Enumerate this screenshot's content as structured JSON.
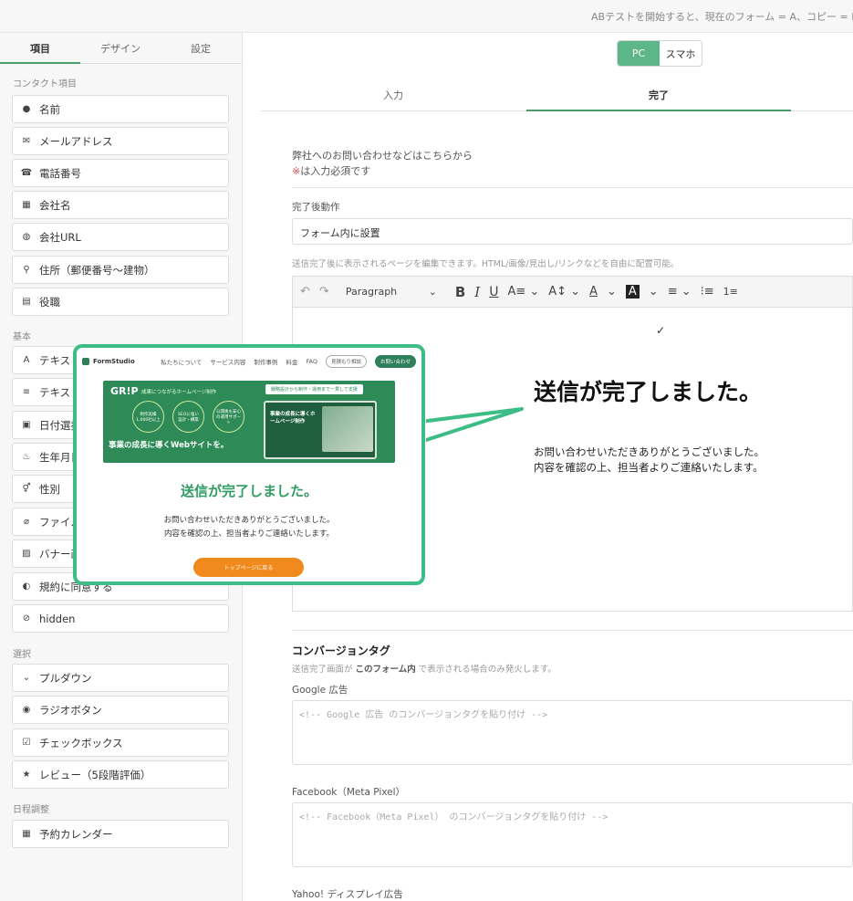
{
  "top_notice": "ABテストを開始すると、現在のフォーム = A、コピー = B とし",
  "sidebar": {
    "tabs": [
      "項目",
      "デザイン",
      "設定"
    ],
    "sections": {
      "contact": "コンタクト項目",
      "basic": "基本",
      "select": "選択",
      "schedule": "日程調整"
    },
    "contact_items": [
      "名前",
      "メールアドレス",
      "電話番号",
      "会社名",
      "会社URL",
      "住所（郵便番号〜建物）",
      "役職"
    ],
    "basic_items": [
      "テキスト",
      "テキスト",
      "日付選択",
      "生年月日",
      "性別",
      "ファイル",
      "バナー画",
      "規約に同意する",
      "hidden"
    ],
    "select_items": [
      "プルダウン",
      "ラジオボタン",
      "チェックボックス",
      "レビュー（5段階評価）"
    ],
    "schedule_items": [
      "予約カレンダー"
    ]
  },
  "main": {
    "device": {
      "pc": "PC",
      "sp": "スマホ"
    },
    "tabs": {
      "input": "入力",
      "complete": "完了"
    },
    "intro_line1": "弊社へのお問い合わせなどはこちらから",
    "intro_mark": "※",
    "intro_line2": "は入力必須です",
    "after_label": "完了後動作",
    "after_value": "フォーム内に設置",
    "editor_hint": "送信完了後に表示されるページを編集できます。HTML/画像/見出し/リンクなどを自由に配置可能。",
    "toolbar": {
      "paragraph": "Paragraph"
    },
    "checkmark": "✓",
    "complete_title": "送信が完了しました。",
    "complete_msg1": "お問い合わせいただきありがとうございました。",
    "complete_msg2": "内容を確認の上、担当者よりご連絡いたします。",
    "conv_heading": "コンバージョンタグ",
    "conv_note_a": "送信完了画面が",
    "conv_note_b": "このフォーム内",
    "conv_note_c": "で表示される場合のみ発火します。",
    "google_label": "Google 広告",
    "google_ph": "<!-- Google 広告 のコンバージョンタグを貼り付け -->",
    "fb_label": "Facebook（Meta Pixel）",
    "fb_ph": "<!-- Facebook（Meta Pixel） のコンバージョンタグを貼り付け -->",
    "yahoo_label": "Yahoo! ディスプレイ広告"
  },
  "preview": {
    "brand": "FormStudio",
    "nav": [
      "私たちについて",
      "サービス内容",
      "制作事例",
      "料金",
      "FAQ"
    ],
    "btn_estimate": "見積もり相談",
    "btn_contact": "お問い合わせ",
    "banner_logo": "GR!P",
    "banner_tagline": "成果につながるホームページ制作",
    "banner_badge1": "制作実績 1,000社以上",
    "banner_badge2": "SEOに強い設計・構築",
    "banner_badge3": "公開後も安心の運用サポート",
    "banner_main": "事業の成長に導くWebサイトを。",
    "banner_ribbon": "戦略設計から制作・運用まで一貫して支援",
    "banner_screen": "事業の成長に導くホームページ制作",
    "title": "送信が完了しました。",
    "msg1": "お問い合わせいただきありがとうございました。",
    "msg2": "内容を確認の上、担当者よりご連絡いたします。",
    "cta": "トップページに戻る"
  },
  "colors": {
    "accent": "#5cb687",
    "callout_border": "#3cbd86",
    "cta": "#f18a1c",
    "banner": "#2e8b57"
  }
}
